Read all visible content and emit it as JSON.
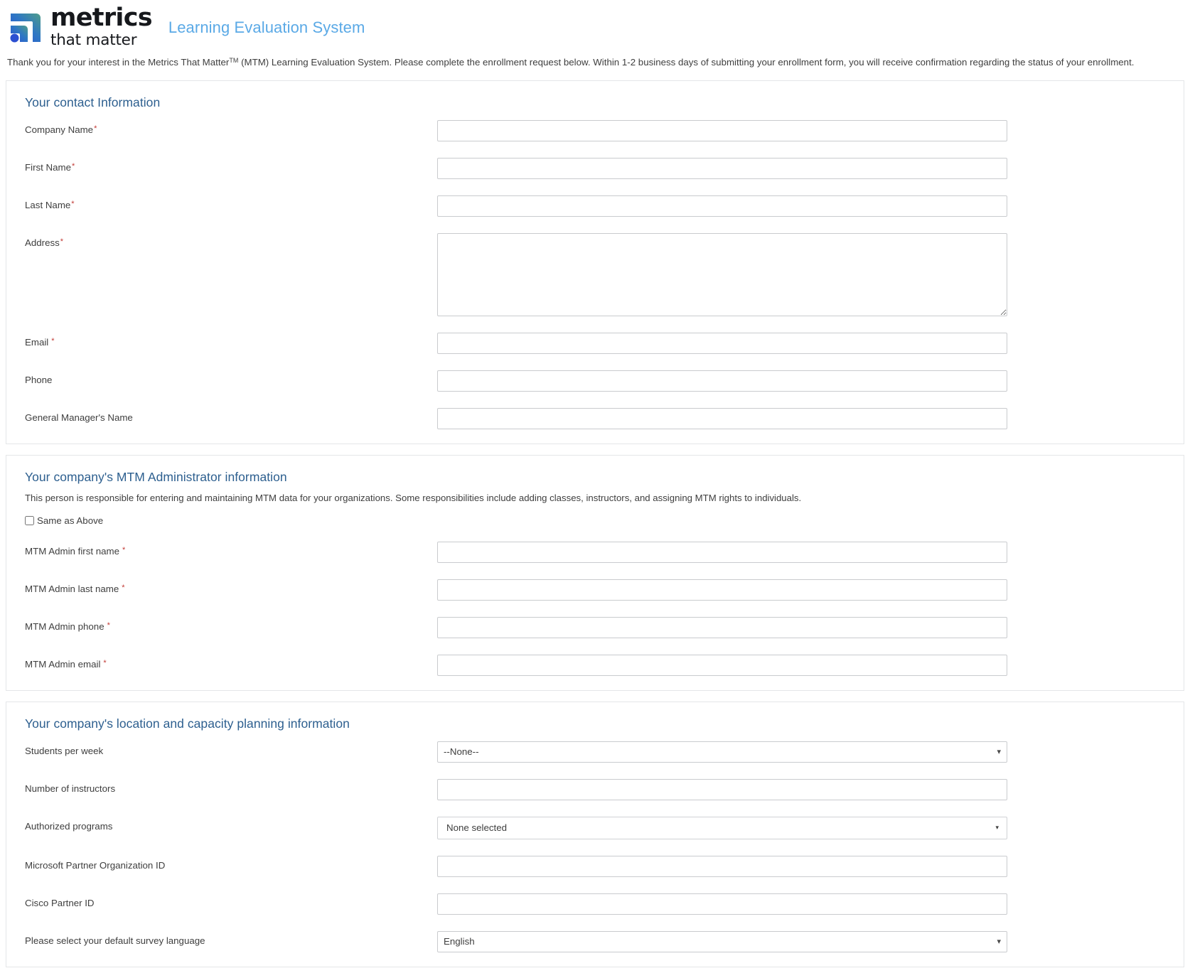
{
  "header": {
    "logo_word_1": "metrics",
    "logo_word_2": "that matter",
    "logo_icon_name": "metrics-that-matter-logo",
    "app_title": "Learning Evaluation System",
    "brand_colors": {
      "app_title_blue": "#5aa9e6",
      "section_header_blue": "#2d5f8f",
      "required_red": "#c23934",
      "logo_gradient_start": "#4f9d8a",
      "logo_gradient_end": "#2b5fd9",
      "input_border": "#c9cbce",
      "panel_border": "#e4e6e8"
    }
  },
  "intro": {
    "part_1": "Thank you for your interest in the Metrics That Matter",
    "superscript": "TM",
    "part_2": " (MTM) Learning Evaluation System. Please complete the enrollment request below. Within 1-2 business days of submitting your enrollment form, you will receive confirmation regarding the status of your enrollment."
  },
  "sections": [
    {
      "title": "Your contact Information",
      "description": "",
      "fields": [
        {
          "label": "Company Name",
          "required": true,
          "required_spaced": false,
          "type": "text",
          "value": "",
          "placeholder": ""
        },
        {
          "label": "First Name",
          "required": true,
          "required_spaced": false,
          "type": "text",
          "value": "",
          "placeholder": ""
        },
        {
          "label": "Last Name",
          "required": true,
          "required_spaced": false,
          "type": "text",
          "value": "",
          "placeholder": ""
        },
        {
          "label": "Address",
          "required": true,
          "required_spaced": false,
          "type": "textarea",
          "value": "",
          "placeholder": ""
        },
        {
          "label": "Email",
          "required": true,
          "required_spaced": true,
          "type": "text",
          "value": "",
          "placeholder": ""
        },
        {
          "label": "Phone",
          "required": false,
          "required_spaced": false,
          "type": "text",
          "value": "",
          "placeholder": ""
        },
        {
          "label": "General Manager's Name",
          "required": false,
          "required_spaced": false,
          "type": "text",
          "value": "",
          "placeholder": ""
        }
      ]
    },
    {
      "title": "Your company's MTM Administrator information",
      "description": "This person is responsible for entering and maintaining MTM data for your organizations. Some responsibilities include adding classes, instructors, and assigning MTM rights to individuals.",
      "checkbox": {
        "label": "Same as Above",
        "checked": false
      },
      "fields": [
        {
          "label": "MTM Admin first name",
          "required": true,
          "required_spaced": true,
          "type": "text",
          "value": "",
          "placeholder": ""
        },
        {
          "label": "MTM Admin last name",
          "required": true,
          "required_spaced": true,
          "type": "text",
          "value": "",
          "placeholder": ""
        },
        {
          "label": "MTM Admin phone",
          "required": true,
          "required_spaced": true,
          "type": "text",
          "value": "",
          "placeholder": ""
        },
        {
          "label": "MTM Admin email",
          "required": true,
          "required_spaced": true,
          "type": "text",
          "value": "",
          "placeholder": ""
        }
      ]
    },
    {
      "title": "Your company's location and capacity planning information",
      "description": "",
      "fields": [
        {
          "label": "Students per week",
          "required": false,
          "required_spaced": false,
          "type": "select",
          "value": "--None--",
          "options": [
            "--None--"
          ]
        },
        {
          "label": "Number of instructors",
          "required": false,
          "required_spaced": false,
          "type": "text",
          "value": "",
          "placeholder": ""
        },
        {
          "label": "Authorized programs",
          "required": false,
          "required_spaced": false,
          "type": "multiselect",
          "value": "None selected",
          "caret": "▾"
        },
        {
          "label": "Microsoft Partner Organization ID",
          "required": false,
          "required_spaced": false,
          "type": "text",
          "value": "",
          "placeholder": ""
        },
        {
          "label": "Cisco Partner ID",
          "required": false,
          "required_spaced": false,
          "type": "text",
          "value": "",
          "placeholder": ""
        },
        {
          "label": "Please select your default survey language",
          "required": false,
          "required_spaced": false,
          "type": "select",
          "value": "English",
          "options": [
            "English"
          ]
        }
      ]
    }
  ]
}
